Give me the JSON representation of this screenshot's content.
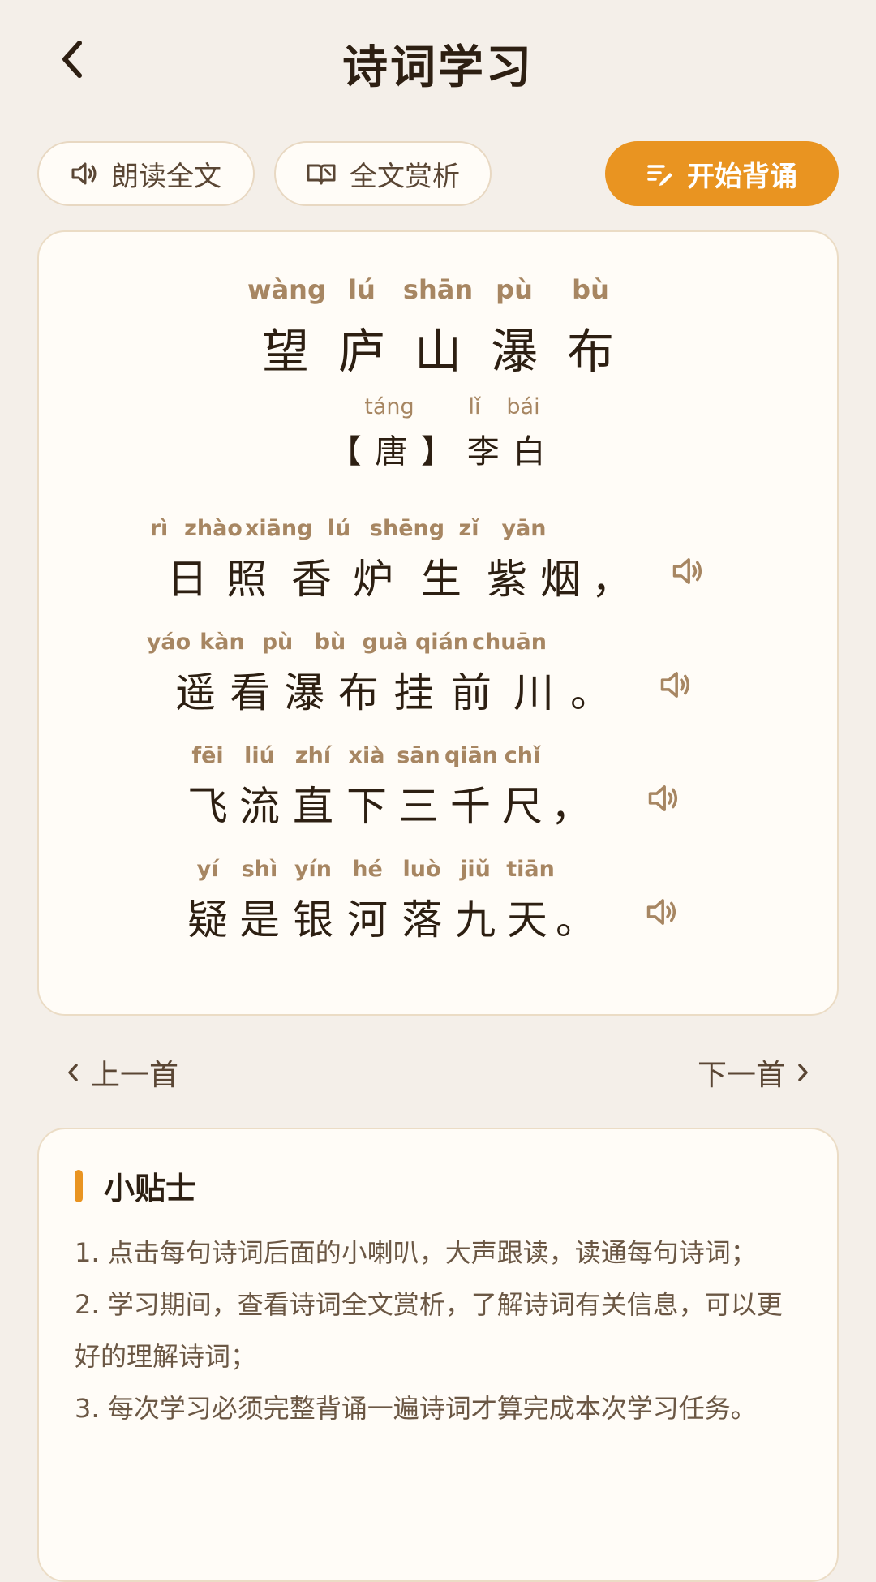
{
  "header": {
    "title": "诗词学习"
  },
  "actions": {
    "read_label": "朗读全文",
    "analysis_label": "全文赏析",
    "recite_label": "开始背诵"
  },
  "poem": {
    "title": {
      "pinyin": [
        "wàng",
        "lú",
        "shān",
        "pù",
        "bù"
      ],
      "chars": [
        "望",
        "庐",
        "山",
        "瀑",
        "布"
      ]
    },
    "author": {
      "pinyin": [
        "táng",
        "lǐ",
        "bái"
      ],
      "text": "【 唐 】 李 白"
    },
    "lines": [
      {
        "pinyin": [
          "rì",
          "zhào",
          "xiāng",
          "lú",
          "shēng",
          "zǐ",
          "yān"
        ],
        "chars": [
          "日",
          "照",
          "香",
          "炉",
          "生",
          "紫",
          "烟",
          "，"
        ]
      },
      {
        "pinyin": [
          "yáo",
          "kàn",
          "pù",
          "bù",
          "guà",
          "qián",
          "chuān"
        ],
        "chars": [
          "遥",
          "看",
          "瀑",
          "布",
          "挂",
          "前",
          "川",
          "。"
        ]
      },
      {
        "pinyin": [
          "fēi",
          "liú",
          "zhí",
          "xià",
          "sān",
          "qiān",
          "chǐ"
        ],
        "chars": [
          "飞",
          "流",
          "直",
          "下",
          "三",
          "千",
          "尺",
          "，"
        ]
      },
      {
        "pinyin": [
          "yí",
          "shì",
          "yín",
          "hé",
          "luò",
          "jiǔ",
          "tiān"
        ],
        "chars": [
          "疑",
          "是",
          "银",
          "河",
          "落",
          "九",
          "天",
          "。"
        ]
      }
    ]
  },
  "nav": {
    "prev_label": "上一首",
    "next_label": "下一首"
  },
  "tips": {
    "title": "小贴士",
    "items": [
      "1. 点击每句诗词后面的小喇叭，大声跟读，读通每句诗词；",
      "2. 学习期间，查看诗词全文赏析，了解诗词有关信息，可以更好的理解诗词；",
      "3. 每次学习必须完整背诵一遍诗词才算完成本次学习任务。"
    ]
  },
  "colors": {
    "accent": "#e99421",
    "pinyin": "#a78662",
    "text": "#2d1f12",
    "background": "#f4efe9"
  },
  "icons": [
    "back-chevron-icon",
    "speaker-icon",
    "book-icon",
    "pen-list-icon",
    "chevron-left-icon",
    "chevron-right-icon"
  ]
}
